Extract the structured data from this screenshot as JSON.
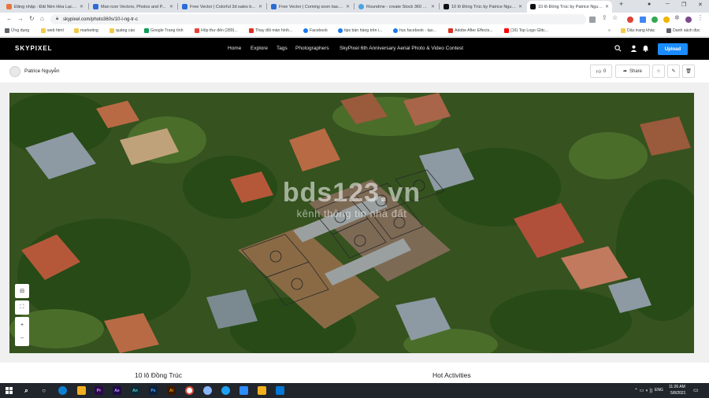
{
  "tabs": [
    {
      "label": "Đăng nhập : Đất Nền Hòa Lạc - ...",
      "color": "#e8743b"
    },
    {
      "label": "Man icon Vectors, Photos and P...",
      "color": "#2b6bd8"
    },
    {
      "label": "Free Vector | Colorful 3d sales b...",
      "color": "#2b6bd8"
    },
    {
      "label": "Free Vector | Coming soon backg...",
      "color": "#2b6bd8"
    },
    {
      "label": "Roundme - create Stock 360 VR...",
      "color": "#4aa3df"
    },
    {
      "label": "10 lô Đồng Trúc by Patrice Nguy...",
      "color": "#111111"
    },
    {
      "label": "10 lô Đồng Trúc by Patrice Nguy...",
      "color": "#111111"
    }
  ],
  "address": {
    "url": "skypixel.com/photo360s/10-l-ng-tr-c"
  },
  "bookmarks": [
    {
      "label": "Ứng dụng",
      "color": "#5f6368"
    },
    {
      "label": "web html",
      "color": "#f2c94c"
    },
    {
      "label": "marketing",
      "color": "#f2c94c"
    },
    {
      "label": "quảng cáo",
      "color": "#f2c94c"
    },
    {
      "label": "Google Trang tính",
      "color": "#0f9d58"
    },
    {
      "label": "Hộp thư đến (289)...",
      "color": "#ea4335"
    },
    {
      "label": "Thay đổi màn hình...",
      "color": "#d93025"
    },
    {
      "label": "Facebook",
      "color": "#1877f2"
    },
    {
      "label": "tips bán hàng trên i...",
      "color": "#1877f2"
    },
    {
      "label": "học facebook - tạo...",
      "color": "#1877f2"
    },
    {
      "label": "Adobe After Effects...",
      "color": "#d93025"
    },
    {
      "label": "(16) Top Logo Glitc...",
      "color": "#ff0000"
    },
    {
      "label": "Dấu trang khác",
      "color": "#f2c94c"
    },
    {
      "label": "Danh sách đọc",
      "color": "#5f6368"
    }
  ],
  "site": {
    "logo": "SKYPIXEL",
    "nav": [
      "Home",
      "Explore",
      "Tags",
      "Photographers",
      "SkyPixel 6th Anniversary Aerial Photo & Video Contest"
    ],
    "upload_label": "Upload"
  },
  "author": {
    "name": "Patrice Nguyễn"
  },
  "actions": {
    "like_count": "0",
    "share_label": "Share"
  },
  "photo": {
    "watermark_main": "bds123.vn",
    "watermark_sub": "kênh thông tin nhà đất"
  },
  "below": {
    "title": "10 lô Đồng Trúc",
    "hot_activities": "Hot Activities"
  },
  "taskbar": {
    "apps": [
      {
        "label": "Pr",
        "color": "#2a0a4a"
      },
      {
        "label": "Ae",
        "color": "#1f0a4a"
      },
      {
        "label": "An",
        "color": "#0a2a3a"
      },
      {
        "label": "Ps",
        "color": "#0a2040"
      },
      {
        "label": "Ai",
        "color": "#3a1a00"
      }
    ],
    "lang": "ENG",
    "time": "11:26 AM",
    "date": "5/8/2021"
  }
}
